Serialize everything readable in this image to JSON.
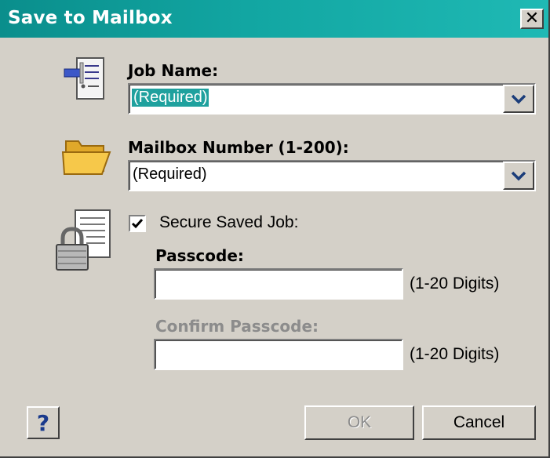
{
  "window": {
    "title": "Save to Mailbox",
    "close_glyph": "✕"
  },
  "job_name": {
    "label": "Job Name:",
    "value": "(Required)",
    "icon": "job-document-icon"
  },
  "mailbox_number": {
    "label": "Mailbox Number (1-200):",
    "value": "(Required)",
    "icon": "folder-icon"
  },
  "secure": {
    "checkbox_label": "Secure Saved Job:",
    "checked": true,
    "icon": "locked-document-icon",
    "passcode_label": "Passcode:",
    "passcode_value": "",
    "passcode_hint": "(1-20 Digits)",
    "confirm_label": "Confirm Passcode:",
    "confirm_value": "",
    "confirm_hint": "(1-20 Digits)"
  },
  "buttons": {
    "help": "?",
    "ok": "OK",
    "cancel": "Cancel"
  },
  "colors": {
    "titlebar": "#12a6a2",
    "selection": "#1fa19e",
    "dialog_bg": "#d4d0c8"
  }
}
